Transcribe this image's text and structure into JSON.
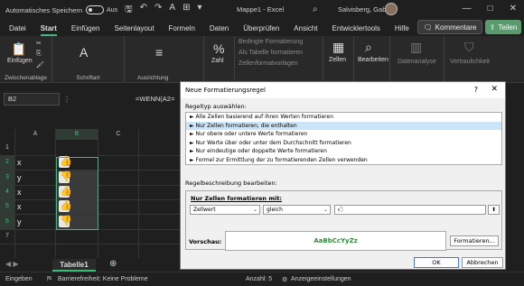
{
  "titlebar": {
    "autosave_label": "Automatisches Speichern",
    "toggle_state": "Aus",
    "doc_title": "Mappe1  -  Excel",
    "user_name": "Salvisberg, Gaby",
    "icons": [
      "save-icon",
      "undo-icon",
      "redo-icon",
      "font-color-icon",
      "borders-icon",
      "customize-icon"
    ]
  },
  "menu": {
    "tabs": [
      "Datei",
      "Start",
      "Einfügen",
      "Seitenlayout",
      "Formeln",
      "Daten",
      "Überprüfen",
      "Ansicht",
      "Entwicklertools",
      "Hilfe"
    ],
    "active": "Start",
    "comments_label": "Kommentare",
    "share_label": "Teilen"
  },
  "ribbon": {
    "paste_label": "Einfügen",
    "clipboard_label": "Zwischenablage",
    "font_label": "Schriftart",
    "align_label": "Ausrichtung",
    "number_label": "Zahl",
    "percent": "%",
    "cond_format": "Bedingte Formatierung",
    "table_format": "Als Tabelle formatieren",
    "cell_styles": "Zellenformatvorlagen",
    "cells_label": "Zellen",
    "edit_label": "Bearbeiten",
    "data_analysis": "Datenanalyse",
    "confidentiality": "Vertraulichkeit"
  },
  "formulabar": {
    "namebox": "B2",
    "formula": "=WENN(A2="
  },
  "grid": {
    "columns": [
      "A",
      "B",
      "C"
    ],
    "rows": [
      "1",
      "2",
      "3",
      "4",
      "5",
      "6",
      "7"
    ],
    "col_a_values": [
      "",
      "x",
      "y",
      "x",
      "x",
      "y",
      ""
    ],
    "col_b_icons": [
      "",
      "thumbs-up-icon",
      "thumbs-down-icon",
      "thumbs-up-icon",
      "thumbs-up-icon",
      "thumbs-down-icon",
      ""
    ]
  },
  "sheets": {
    "active": "Tabelle1",
    "add_label": "⊕"
  },
  "status": {
    "ready": "Eingeben",
    "accessibility": "Barrierefreiheit: Keine Probleme",
    "count": "Anzahl: 5",
    "display_settings": "Anzeigeeinstellungen"
  },
  "dialog": {
    "title": "Neue Formatierungsregel",
    "help": "?",
    "close": "✕",
    "rule_type_label": "Regeltyp auswählen:",
    "rule_types": [
      "► Alle Zellen basierend auf ihren Werten formatieren",
      "► Nur Zellen formatieren, die enthalten",
      "► Nur obere oder untere Werte formatieren",
      "► Nur Werte über oder unter dem Durchschnitt formatieren",
      "► Nur eindeutige oder doppelte Werte formatieren",
      "► Formel zur Ermittlung der zu formatierenden Zellen verwenden"
    ],
    "selected_index": 1,
    "desc_label": "Regelbeschreibung bearbeiten:",
    "format_only_label": "Nur Zellen formatieren mit:",
    "field1": "Zellwert",
    "field2": "gleich",
    "field3": "🖒",
    "preview_label": "Vorschau:",
    "preview_text": "AaBbCcYyZz",
    "format_button": "Formatieren...",
    "ok_button": "OK",
    "cancel_button": "Abbrechen"
  }
}
